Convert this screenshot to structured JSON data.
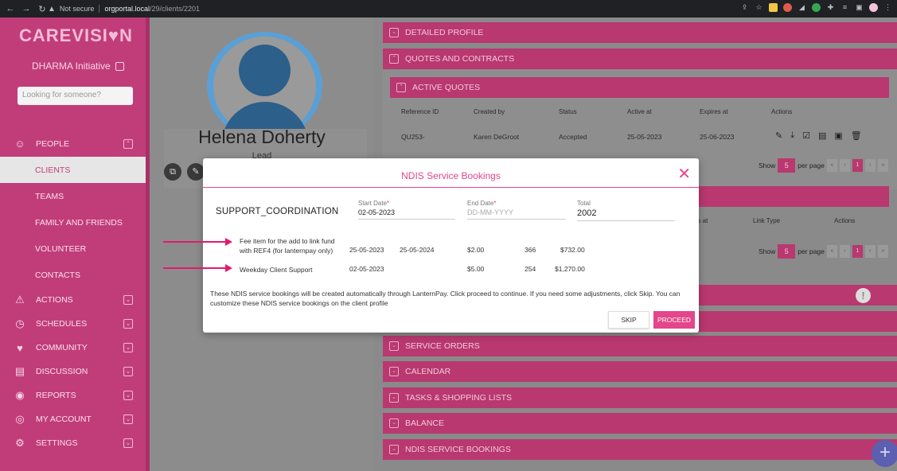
{
  "browser": {
    "security": "Not secure",
    "host": "orgportal.local",
    "path": "/29/clients/2201"
  },
  "sidebar": {
    "logo": "CAREVISI♥N",
    "org": "DHARMA Initiative",
    "search_placeholder": "Looking for someone?",
    "people": "PEOPLE",
    "sub_items": [
      "CLIENTS",
      "TEAMS",
      "FAMILY AND FRIENDS",
      "VOLUNTEER",
      "CONTACTS"
    ],
    "items": [
      "ACTIONS",
      "SCHEDULES",
      "COMMUNITY",
      "DISCUSSION",
      "REPORTS",
      "MY ACCOUNT",
      "SETTINGS"
    ]
  },
  "profile": {
    "name": "Helena Doherty",
    "role": "Lead"
  },
  "panels": {
    "detailed_profile": "DETAILED PROFILE",
    "quotes_contracts": "QUOTES AND CONTRACTS",
    "active_quotes": "ACTIVE QUOTES",
    "service_orders": "SERVICE ORDERS",
    "calendar": "CALENDAR",
    "tasks": "TASKS & SHOPPING LISTS",
    "balance": "BALANCE",
    "ndis_bookings": "NDIS SERVICE BOOKINGS"
  },
  "quotes_table": {
    "headers": [
      "Reference ID",
      "Created by",
      "Status",
      "Active at",
      "Expires at",
      "Actions"
    ],
    "row": [
      "QU253-",
      "Karen DeGroot",
      "Accepted",
      "25-05-2023",
      "25-06-2023"
    ]
  },
  "second_table": {
    "headers": [
      "es at",
      "Link Type",
      "Actions"
    ]
  },
  "pager": {
    "show": "Show",
    "per_page_value": "5",
    "per_page": "per page",
    "current_page": "1",
    "first": "«",
    "prev": "‹",
    "next": "›",
    "last": "»"
  },
  "modal": {
    "title": "NDIS Service Bookings",
    "service": "SUPPORT_COORDINATION",
    "start_label": "Start Date",
    "start_value": "02-05-2023",
    "end_label": "End Date",
    "end_placeholder": "DD-MM-YYYY",
    "total_label": "Total",
    "total_value": "2002",
    "rows": [
      {
        "desc": "Fee item for the add to link fund with REF4 (for lanternpay only)",
        "start": "25-05-2023",
        "end": "25-05-2024",
        "rate": "$2.00",
        "qty": "366",
        "amount": "$732.00"
      },
      {
        "desc": "Weekday Client Support",
        "start": "02-05-2023",
        "end": "",
        "rate": "$5.00",
        "qty": "254",
        "amount": "$1,270.00"
      }
    ],
    "note": "These NDIS service bookings will be created automatically through LanternPay. Click proceed to continue. If you need some adjustments, click Skip. You can customize these NDIS service bookings on the client profile",
    "skip": "SKIP",
    "proceed": "PROCEED"
  },
  "colors": {
    "brand": "#c13d7a",
    "accent": "#e3468a",
    "annotation": "#e31a6e"
  }
}
